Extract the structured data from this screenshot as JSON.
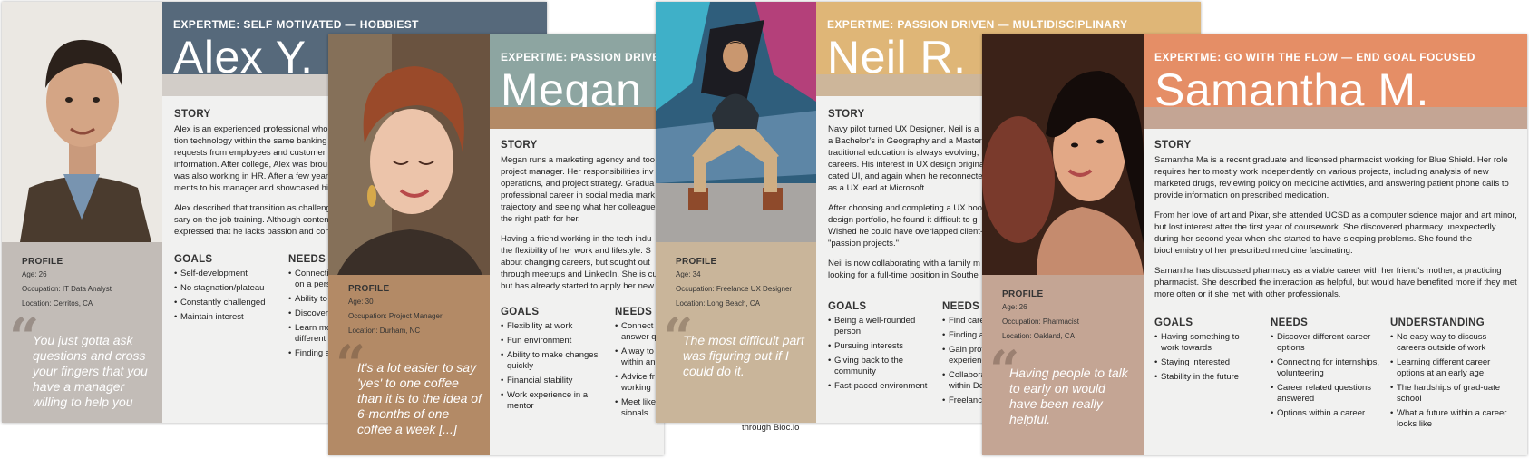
{
  "cards": {
    "alex": {
      "tagline": "EXPERTME: SELF MOTIVATED — HOBBIEST",
      "name": "Alex Y.",
      "story_heading": "STORY",
      "story_lines": [
        "Alex is an experienced professional who",
        "tion technology within the same banking",
        "requests from employees and customer",
        "information. After college, Alex was brou",
        "was also working in HR. After a few years",
        "ments to his manager and showcased hi"
      ],
      "story_lines_2": [
        "Alex described that transition as challeng",
        "sary on-the-job training. Although conten",
        "expressed that he lacks passion and conn"
      ],
      "profile_heading": "PROFILE",
      "profile": [
        "Age: 26",
        "Occupation: IT Data Analyst",
        "Location: Cerritos, CA"
      ],
      "goals_heading": "GOALS",
      "goals": [
        "Self-development",
        "No stagnation/plateau",
        "Constantly challenged",
        "Maintain interest"
      ],
      "needs_heading": "NEEDS",
      "needs": [
        "Connecti on a pers",
        "Ability to",
        "Discover",
        "Learn mo different",
        "Finding a"
      ],
      "quote": "You just gotta ask questions and cross your fingers that you have a manager willing to help you"
    },
    "megan": {
      "tagline": "EXPERTME: PASSION DRIVEN —",
      "name": "Megan",
      "story_heading": "STORY",
      "story_lines": [
        "Megan runs a marketing agency and too",
        "project manager. Her responsibilities inv",
        "operations, and project strategy. Gradua",
        "professional career in social media mark",
        "trajectory and seeing what her colleague",
        "the right path for her."
      ],
      "story_lines_2": [
        "Having a friend working in the tech indu",
        "the flexibility of her work and lifestyle. S",
        "about changing careers, but sought out",
        "through meetups and LinkedIn. She is cu",
        "but has already started to apply her new"
      ],
      "profile_heading": "PROFILE",
      "profile": [
        "Age: 30",
        "Occupation: Project Manager",
        "Location: Durham, NC"
      ],
      "goals_heading": "GOALS",
      "goals": [
        "Flexibility at work",
        "Fun environment",
        "Ability to make changes quickly",
        "Financial stability",
        "Work experience in a mentor"
      ],
      "needs_heading": "NEEDS",
      "needs": [
        "Connect answer q",
        "A way to within an",
        "Advice fr working",
        "Meet like sionals"
      ],
      "quote": "It's a lot easier to say 'yes' to one coffee than it is to the idea of 6-months of one coffee a week [...]"
    },
    "neil": {
      "tagline": "EXPERTME: PASSION DRIVEN — MULTIDISCIPLINARY",
      "name": "Neil R.",
      "story_heading": "STORY",
      "story_lines": [
        "Navy pilot turned UX Designer, Neil is a",
        "a Bachelor's in Geography and a Master's",
        "traditional education is always evolving,",
        "careers. His interest in UX design origina",
        "cated UI, and again when he reconnecte",
        "as a UX lead at Microsoft."
      ],
      "story_lines_2": [
        "After choosing and completing a UX boo",
        "design portfolio, he found it difficult to g",
        "Wished he could have overlapped client-",
        "\"passion projects.\""
      ],
      "story_lines_3": [
        "Neil is now collaborating with a family m",
        "looking for a full-time position in Southe"
      ],
      "profile_heading": "PROFILE",
      "profile": [
        "Age: 34",
        "Occupation: Freelance UX Designer",
        "Location: Long Beach, CA"
      ],
      "goals_heading": "GOALS",
      "goals": [
        "Being a well-rounded person",
        "Pursuing interests",
        "Giving back to the community",
        "Fast-paced environment"
      ],
      "needs_heading": "NEEDS",
      "needs": [
        "Find care",
        "Finding a",
        "Gain prof experienc",
        "Collabora within De",
        "Freelanc"
      ],
      "quote": "The most difficult part was figuring out if I could do it.",
      "clip_text": "through Bloc.io"
    },
    "samantha": {
      "tagline": "EXPERTME: GO WITH THE FLOW — END GOAL FOCUSED",
      "name": "Samantha M.",
      "story_heading": "STORY",
      "story_p1": "Samantha Ma is a recent graduate and licensed pharmacist working for Blue Shield. Her role requires her to mostly work independently on various projects, including analysis of new marketed drugs, reviewing policy on medicine activities, and answering patient phone calls to provide information on prescribed medication.",
      "story_p2": "From her love of art and Pixar, she attended UCSD as a computer science major and art minor, but lost interest after the first year of coursework. She discovered pharmacy unexpectedly during her second year when she started to have sleeping problems. She found the biochemistry of her prescribed medicine fascinating.",
      "story_p3": "Samantha has discussed pharmacy as a viable career with her friend's mother, a practicing pharmacist. She described the interaction as helpful, but would have benefited more if they met more often or if she met with other professionals.",
      "profile_heading": "PROFILE",
      "profile": [
        "Age: 26",
        "Occupation: Pharmacist",
        "Location: Oakland, CA"
      ],
      "goals_heading": "GOALS",
      "goals": [
        "Having something to work towards",
        "Staying interested",
        "Stability in the future"
      ],
      "needs_heading": "NEEDS",
      "needs": [
        "Discover different career options",
        "Connecting for internships, volunteering",
        "Career related questions answered",
        "Options within a career"
      ],
      "understanding_heading": "UNDERSTANDING",
      "understanding": [
        "No easy way to discuss careers outside of work",
        "Learning different career options at an early age",
        "The hardships of grad-uate school",
        "What a future within a career looks like"
      ],
      "quote": "Having people to talk to early on would have been really helpful."
    }
  },
  "colors": {
    "alex_header": "#56697b",
    "megan_header": "#8da5a1",
    "neil_header": "#dfb677",
    "samantha_header": "#e58e66",
    "alex_profile": "#c2bcb7",
    "megan_profile": "#b38a66",
    "neil_profile": "#c9b59a",
    "samantha_profile": "#c4a594",
    "body_bg": "#f1f1f0"
  }
}
